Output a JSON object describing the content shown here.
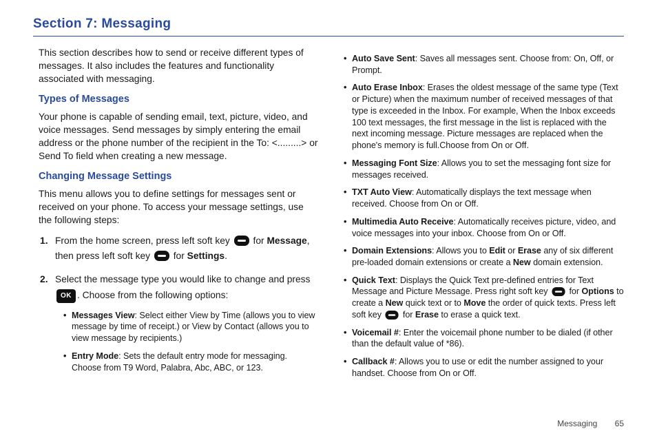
{
  "title": "Section 7:  Messaging",
  "intro": "This section describes how to send or receive different types of messages. It also includes the features and functionality associated with messaging.",
  "types_heading": "Types of Messages",
  "types_body": "Your phone is capable of sending email, text, picture, video, and voice messages. Send messages by simply entering the email address or the phone number of the recipient in the To: <.........> or Send To field when creating a new message.",
  "settings_heading": "Changing Message Settings",
  "settings_intro": "This menu allows you to define settings for messages sent or received on your phone. To access your message settings, use the following steps:",
  "step1": {
    "a": "From the home screen, press left soft key ",
    "b": " for ",
    "c": "Message",
    "d": ", then press left soft key ",
    "e": " for ",
    "f": "Settings",
    "g": "."
  },
  "step2": {
    "a": "Select the message type you would like to change and press ",
    "b": ". Choose from the following options:"
  },
  "left_opts": [
    {
      "t": "Messages View",
      "d": ": Select either View by Time (allows you to view message by time of receipt.) or View by Contact (allows you to view message by recipients.)"
    },
    {
      "t": "Entry Mode",
      "d": ": Sets the default entry mode for messaging. Choose from T9 Word, Palabra, Abc, ABC, or 123."
    }
  ],
  "right_opts": {
    "auto_save_sent": {
      "t": "Auto Save Sent",
      "d": ": Saves all messages sent. Choose from: On, Off, or Prompt."
    },
    "auto_erase_inbox": {
      "t": "Auto Erase Inbox",
      "d": ": Erases the oldest message of the same type (Text or Picture) when the maximum number of received messages of that type is exceeded in the Inbox. For example, When the Inbox exceeds 100 text messages, the first message in the list is replaced with the next incoming message. Picture messages are replaced when the phone's memory is full.Choose from On or Off."
    },
    "font_size": {
      "t": "Messaging Font Size",
      "d": ": Allows you to set the messaging font size for messages received."
    },
    "txt_auto_view": {
      "t": "TXT Auto View",
      "d": ": Automatically displays the text message when received. Choose from On or Off."
    },
    "mm_auto_recv": {
      "t": "Multimedia Auto Receive",
      "d": ": Automatically receives picture, video, and voice messages into your inbox. Choose from On or Off."
    },
    "domain_ext": {
      "t": "Domain Extensions",
      "a": ": Allows you to ",
      "b": "Edit",
      "c": " or ",
      "d": "Erase",
      "e": " any of six different pre-loaded domain extensions or create a ",
      "f": "New",
      "g": " domain extension."
    },
    "quick_text": {
      "t": "Quick Text",
      "a": ": Displays the Quick Text pre-defined entries for Text Message and Picture Message. Press right soft key ",
      "b": " for ",
      "c": "Options",
      "d": " to create a ",
      "e": "New",
      "f": " quick text or to ",
      "g": "Move",
      "h": " the order of quick texts. Press left soft key ",
      "i": " for ",
      "j": "Erase",
      "k": " to erase a quick text."
    },
    "voicemail": {
      "t": "Voicemail #",
      "d": ": Enter the voicemail phone number to be dialed (if other than the default value of *86)."
    },
    "callback": {
      "t": "Callback #",
      "d": ": Allows you to use or edit the number assigned to your handset. Choose from On or Off."
    }
  },
  "ok_label": "OK",
  "footer": {
    "label": "Messaging",
    "page": "65"
  }
}
